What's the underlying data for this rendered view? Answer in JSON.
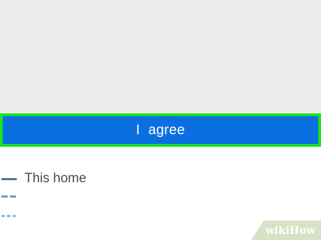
{
  "button": {
    "label": "I  agree"
  },
  "list": {
    "item_label": "This home"
  },
  "watermark": {
    "text": "wikiHow"
  },
  "colors": {
    "button_bg": "#0a6fe0",
    "highlight_border": "#19e41c",
    "panel_bg": "#ececec"
  }
}
